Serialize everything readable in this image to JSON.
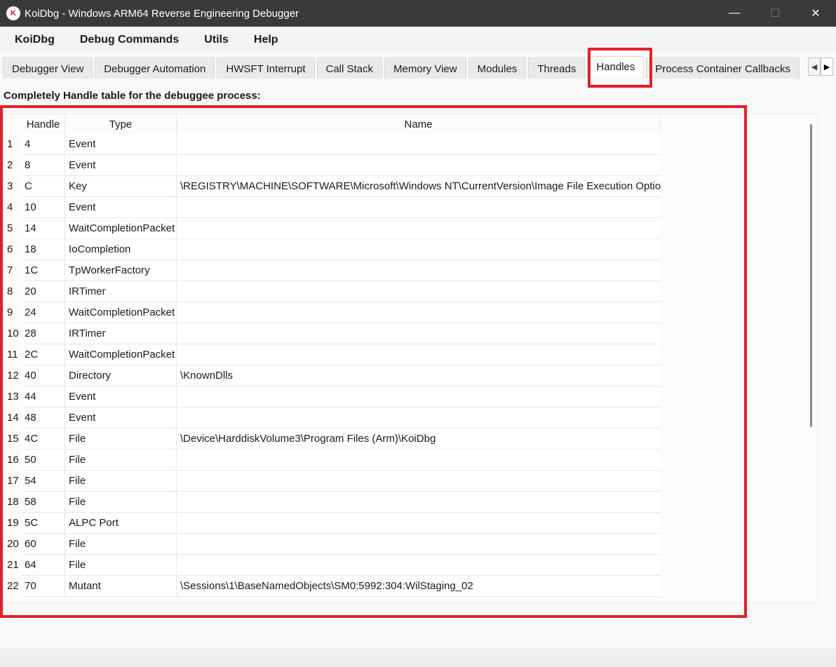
{
  "window": {
    "title": "KoiDbg - Windows ARM64 Reverse Engineering Debugger",
    "app_icon_glyph": "K",
    "controls": {
      "minimize": "—",
      "maximize": "☐",
      "close": "✕"
    }
  },
  "menu": {
    "items": [
      "KoiDbg",
      "Debug Commands",
      "Utils",
      "Help"
    ]
  },
  "tabs": {
    "items": [
      {
        "label": "Debugger View"
      },
      {
        "label": "Debugger Automation"
      },
      {
        "label": "HWSFT Interrupt"
      },
      {
        "label": "Call Stack"
      },
      {
        "label": "Memory View"
      },
      {
        "label": "Modules"
      },
      {
        "label": "Threads"
      },
      {
        "label": "Handles",
        "active": true
      },
      {
        "label": "Process Container Callbacks"
      }
    ],
    "scroll_left": "◀",
    "scroll_right": "▶"
  },
  "heading": "Completely Handle table for the debuggee process:",
  "table": {
    "columns": [
      "",
      "Handle",
      "Type",
      "Name"
    ],
    "rows": [
      [
        "1",
        "4",
        "Event",
        ""
      ],
      [
        "2",
        "8",
        "Event",
        ""
      ],
      [
        "3",
        "C",
        "Key",
        "\\REGISTRY\\MACHINE\\SOFTWARE\\Microsoft\\Windows NT\\CurrentVersion\\Image File Execution Options"
      ],
      [
        "4",
        "10",
        "Event",
        ""
      ],
      [
        "5",
        "14",
        "WaitCompletionPacket",
        ""
      ],
      [
        "6",
        "18",
        "IoCompletion",
        ""
      ],
      [
        "7",
        "1C",
        "TpWorkerFactory",
        ""
      ],
      [
        "8",
        "20",
        "IRTimer",
        ""
      ],
      [
        "9",
        "24",
        "WaitCompletionPacket",
        ""
      ],
      [
        "10",
        "28",
        "IRTimer",
        ""
      ],
      [
        "11",
        "2C",
        "WaitCompletionPacket",
        ""
      ],
      [
        "12",
        "40",
        "Directory",
        "\\KnownDlls"
      ],
      [
        "13",
        "44",
        "Event",
        ""
      ],
      [
        "14",
        "48",
        "Event",
        ""
      ],
      [
        "15",
        "4C",
        "File",
        "\\Device\\HarddiskVolume3\\Program Files (Arm)\\KoiDbg"
      ],
      [
        "16",
        "50",
        "File",
        ""
      ],
      [
        "17",
        "54",
        "File",
        ""
      ],
      [
        "18",
        "58",
        "File",
        ""
      ],
      [
        "19",
        "5C",
        "ALPC Port",
        ""
      ],
      [
        "20",
        "60",
        "File",
        ""
      ],
      [
        "21",
        "64",
        "File",
        ""
      ],
      [
        "22",
        "70",
        "Mutant",
        "\\Sessions\\1\\BaseNamedObjects\\SM0:5992:304:WilStaging_02"
      ]
    ]
  },
  "colors": {
    "titlebar_bg": "#3a3a3a",
    "highlight": "#e3202a",
    "background": "#f9f9f9"
  }
}
